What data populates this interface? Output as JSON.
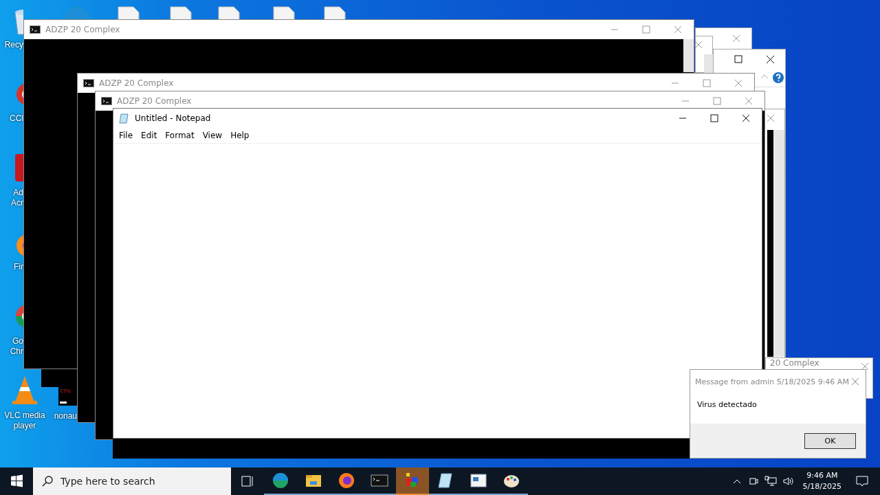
{
  "desktop_icons": [
    {
      "kind": "recycle-bin",
      "lines": [
        "Recy"
      ]
    },
    {
      "kind": "ccleaner",
      "lines": [
        "CCl"
      ]
    },
    {
      "kind": "acrobat",
      "lines": [
        "Ad",
        "Acr"
      ]
    },
    {
      "kind": "firefox",
      "lines": [
        "Fir"
      ]
    },
    {
      "kind": "chrome",
      "lines": [
        "Go",
        "Chr"
      ]
    },
    {
      "kind": "vlc",
      "lines": [
        "VLC media",
        "player"
      ]
    },
    {
      "kind": "console",
      "lines": [
        "nonau"
      ]
    }
  ],
  "windows": [
    {
      "title": "ADZP 20 Complex"
    },
    {
      "title": "ADZP 20 Complex"
    },
    {
      "title": "ADZP 20 Complex"
    }
  ],
  "console_text": "cou",
  "back_window": {
    "title": "20 Complex"
  },
  "notepad": {
    "title": "Untitled - Notepad",
    "menu": [
      "File",
      "Edit",
      "Format",
      "View",
      "Help"
    ]
  },
  "message_box": {
    "title": "Message from admin 5/18/2025 9:46 AM",
    "body": "Virus detectado",
    "button": "OK"
  },
  "taskbar": {
    "search_placeholder": "Type here to search",
    "apps": [
      {
        "kind": "edge",
        "selected": false
      },
      {
        "kind": "explorer",
        "selected": false
      },
      {
        "kind": "firefox",
        "selected": false
      },
      {
        "kind": "console",
        "selected": false
      },
      {
        "kind": "cubes",
        "selected": true
      },
      {
        "kind": "notepad",
        "selected": false
      },
      {
        "kind": "form",
        "selected": false
      },
      {
        "kind": "paint",
        "selected": false
      }
    ],
    "time": "9:46 AM",
    "date": "5/18/2025"
  }
}
